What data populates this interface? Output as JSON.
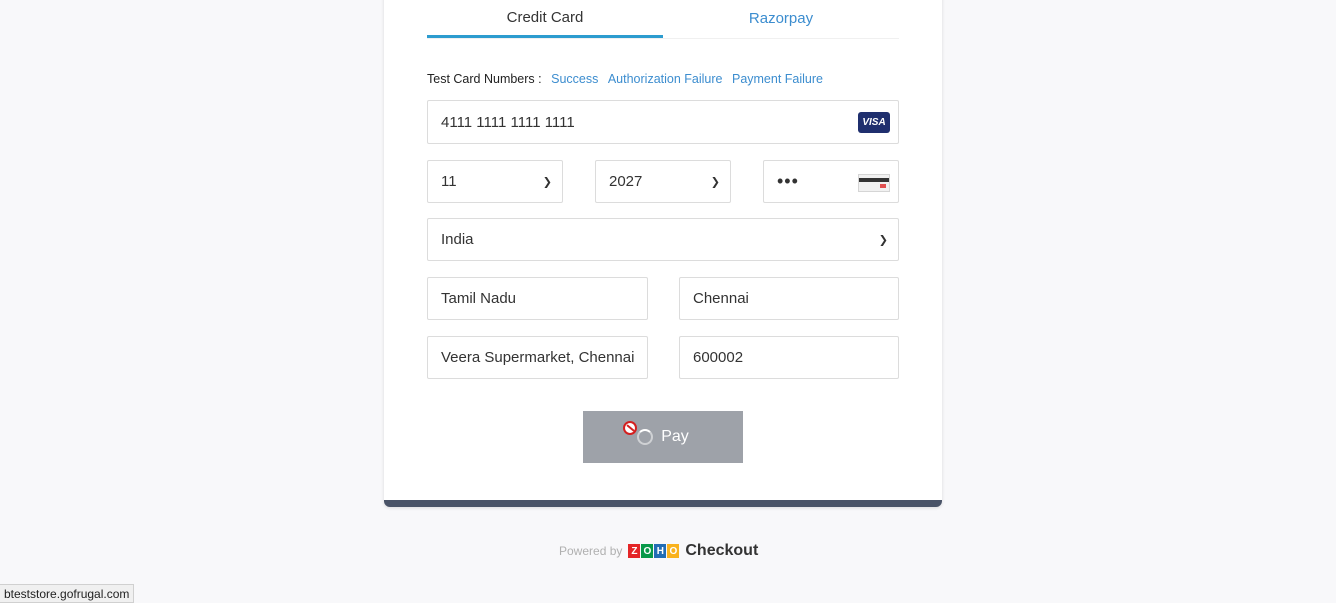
{
  "tabs": [
    {
      "label": "Credit Card",
      "active": true
    },
    {
      "label": "Razorpay",
      "active": false
    }
  ],
  "test_cards": {
    "label": "Test Card Numbers :",
    "links": [
      "Success",
      "Authorization Failure",
      "Payment Failure"
    ]
  },
  "card": {
    "number": "4111 1111 1111 1111",
    "brand": "VISA",
    "exp_month": "11",
    "exp_year": "2027",
    "cvv_masked": "•••"
  },
  "address": {
    "country": "India",
    "state": "Tamil Nadu",
    "city": "Chennai",
    "street": "Veera Supermarket, Chennai",
    "zip": "600002"
  },
  "pay_button": {
    "label": "Pay"
  },
  "footer": {
    "powered_by": "Powered by",
    "zoho_letters": [
      "Z",
      "O",
      "H",
      "O"
    ],
    "checkout": "Checkout"
  },
  "status_bar": {
    "url": "bteststore.gofrugal.com"
  },
  "colors": {
    "accent": "#2d9ccf",
    "link": "#3c8dcf",
    "card_footer": "#4a5468",
    "pay_disabled": "#9ea2a9"
  }
}
